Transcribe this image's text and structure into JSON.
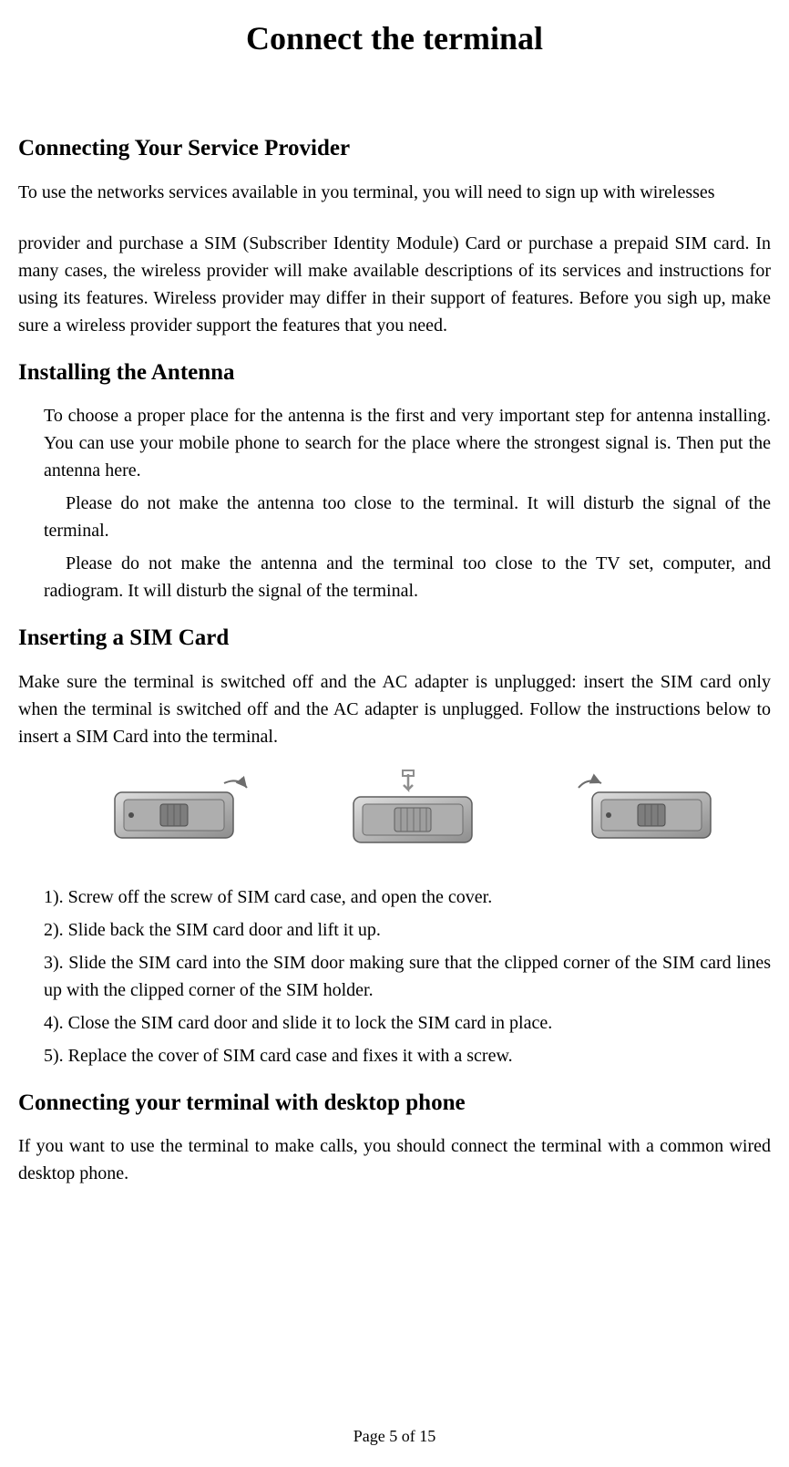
{
  "title": "Connect the terminal",
  "sections": {
    "service_provider": {
      "heading": "Connecting Your Service Provider",
      "para1": "To use the networks services available in you terminal, you will need to sign up with wirelesses",
      "para2": "provider and purchase a SIM (Subscriber Identity Module) Card or purchase a prepaid SIM card. In many cases, the wireless provider will make available descriptions of its services and instructions for using its features. Wireless provider may differ in their support of features. Before you sigh up, make sure a wireless provider support the features that you need."
    },
    "antenna": {
      "heading": "Installing the Antenna",
      "para1": "To choose a proper place for the antenna is the first and very important step for antenna installing. You can use your mobile phone to search for the place where the strongest signal is. Then put the antenna here.",
      "para2": "Please do not make the antenna too close to the terminal. It will disturb the signal of the terminal.",
      "para3": "Please do not make the antenna and the terminal too close to the TV set, computer, and radiogram. It will disturb the signal of the terminal."
    },
    "sim_card": {
      "heading": "Inserting a SIM Card",
      "intro": "Make sure the terminal is switched off and the AC adapter is unplugged: insert the SIM card only when the terminal is switched off and the AC adapter is unplugged. Follow the instructions below to insert a SIM Card into the terminal.",
      "steps": {
        "s1": "1). Screw off the screw of SIM card case, and open the cover.",
        "s2": "2). Slide back the SIM card door and lift it up.",
        "s3": "3). Slide the SIM card into the SIM door making sure that the clipped corner of the SIM card lines up with the clipped corner of the SIM holder.",
        "s4": "4). Close the SIM card door and slide it to lock the SIM card in place.",
        "s5": "5). Replace the cover of SIM card case and fixes it with a screw."
      }
    },
    "desktop_phone": {
      "heading": "Connecting your terminal with desktop phone",
      "para1": "If you want to use the terminal to make calls, you should connect the terminal with a common wired desktop phone."
    }
  },
  "footer": "Page 5 of 15"
}
